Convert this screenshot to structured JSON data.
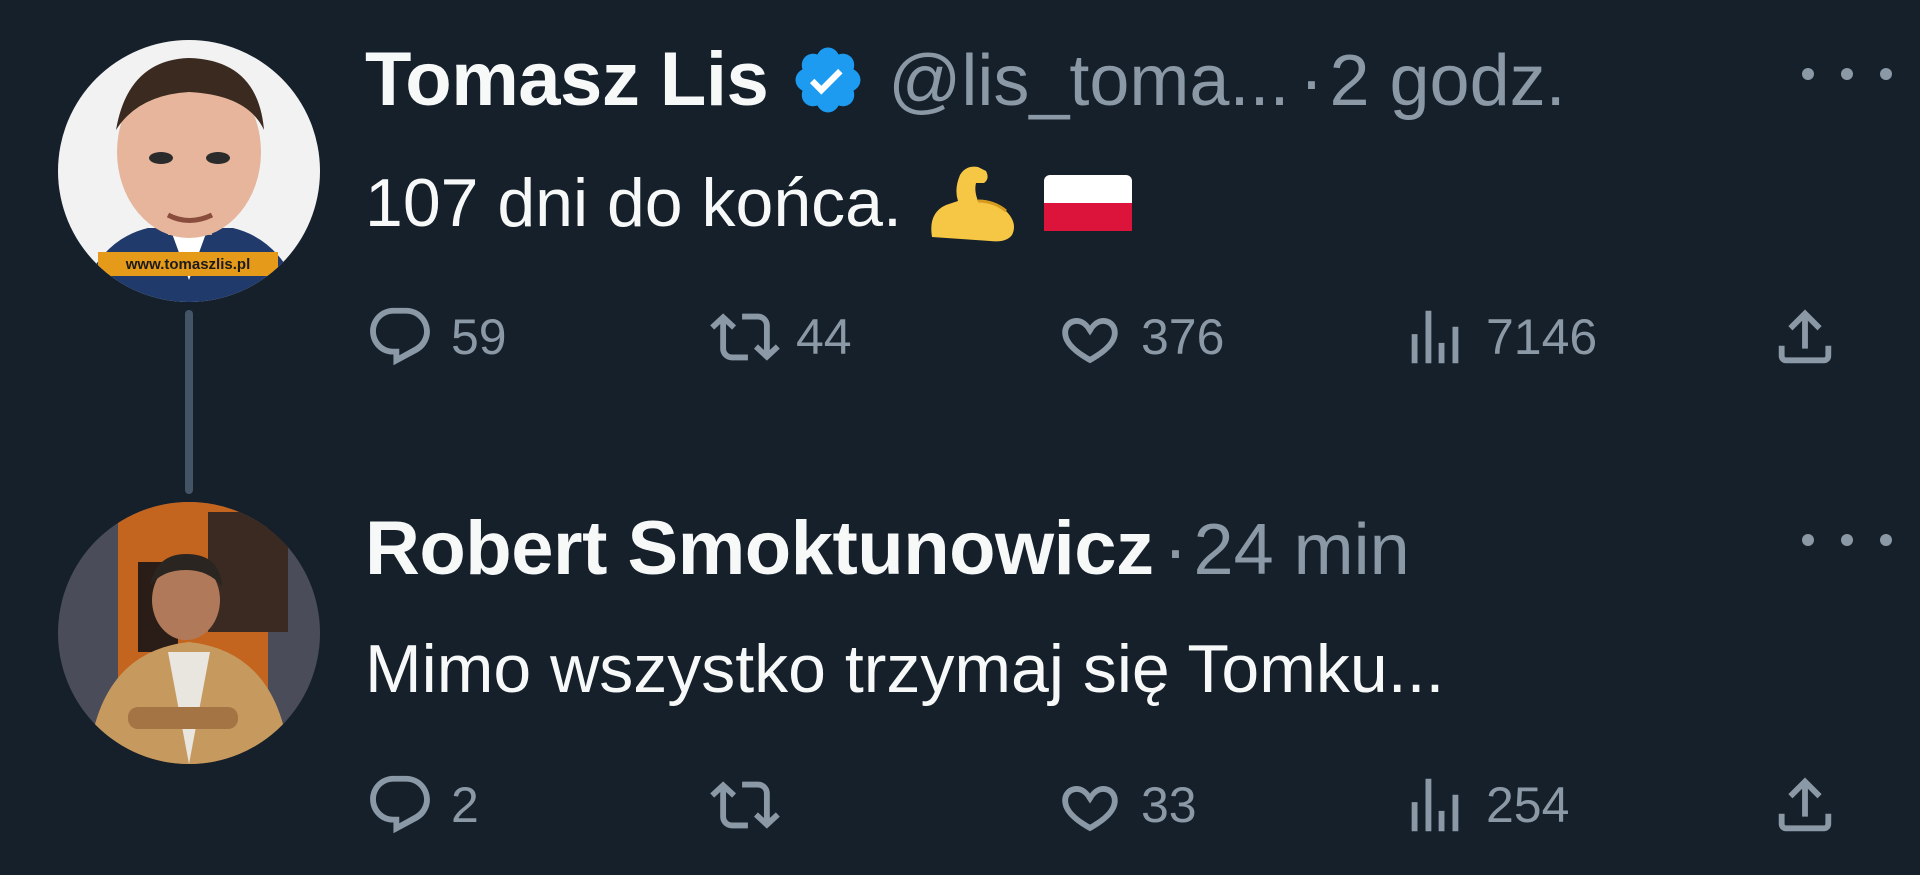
{
  "tweets": [
    {
      "author_name": "Tomasz Lis",
      "handle": "@lis_toma...",
      "separator": "·",
      "time": "2 godz.",
      "verified": true,
      "text": "107 dni do końca.",
      "emojis": [
        "flexed-biceps",
        "flag-poland"
      ],
      "avatar_watermark": "www.tomaszlis.pl",
      "stats": {
        "replies": "59",
        "retweets": "44",
        "likes": "376",
        "views": "7146"
      }
    },
    {
      "author_name": "Robert Smoktunowicz",
      "separator": "·",
      "time": "24 min",
      "verified": false,
      "text": "Mimo wszystko trzymaj się Tomku...",
      "stats": {
        "replies": "2",
        "retweets": "",
        "likes": "33",
        "views": "254"
      }
    }
  ],
  "colors": {
    "background": "#15202b",
    "text_primary": "#f7f9f9",
    "text_secondary": "#8b98a5",
    "verified": "#1d9bf0",
    "thread_line": "#425466"
  }
}
